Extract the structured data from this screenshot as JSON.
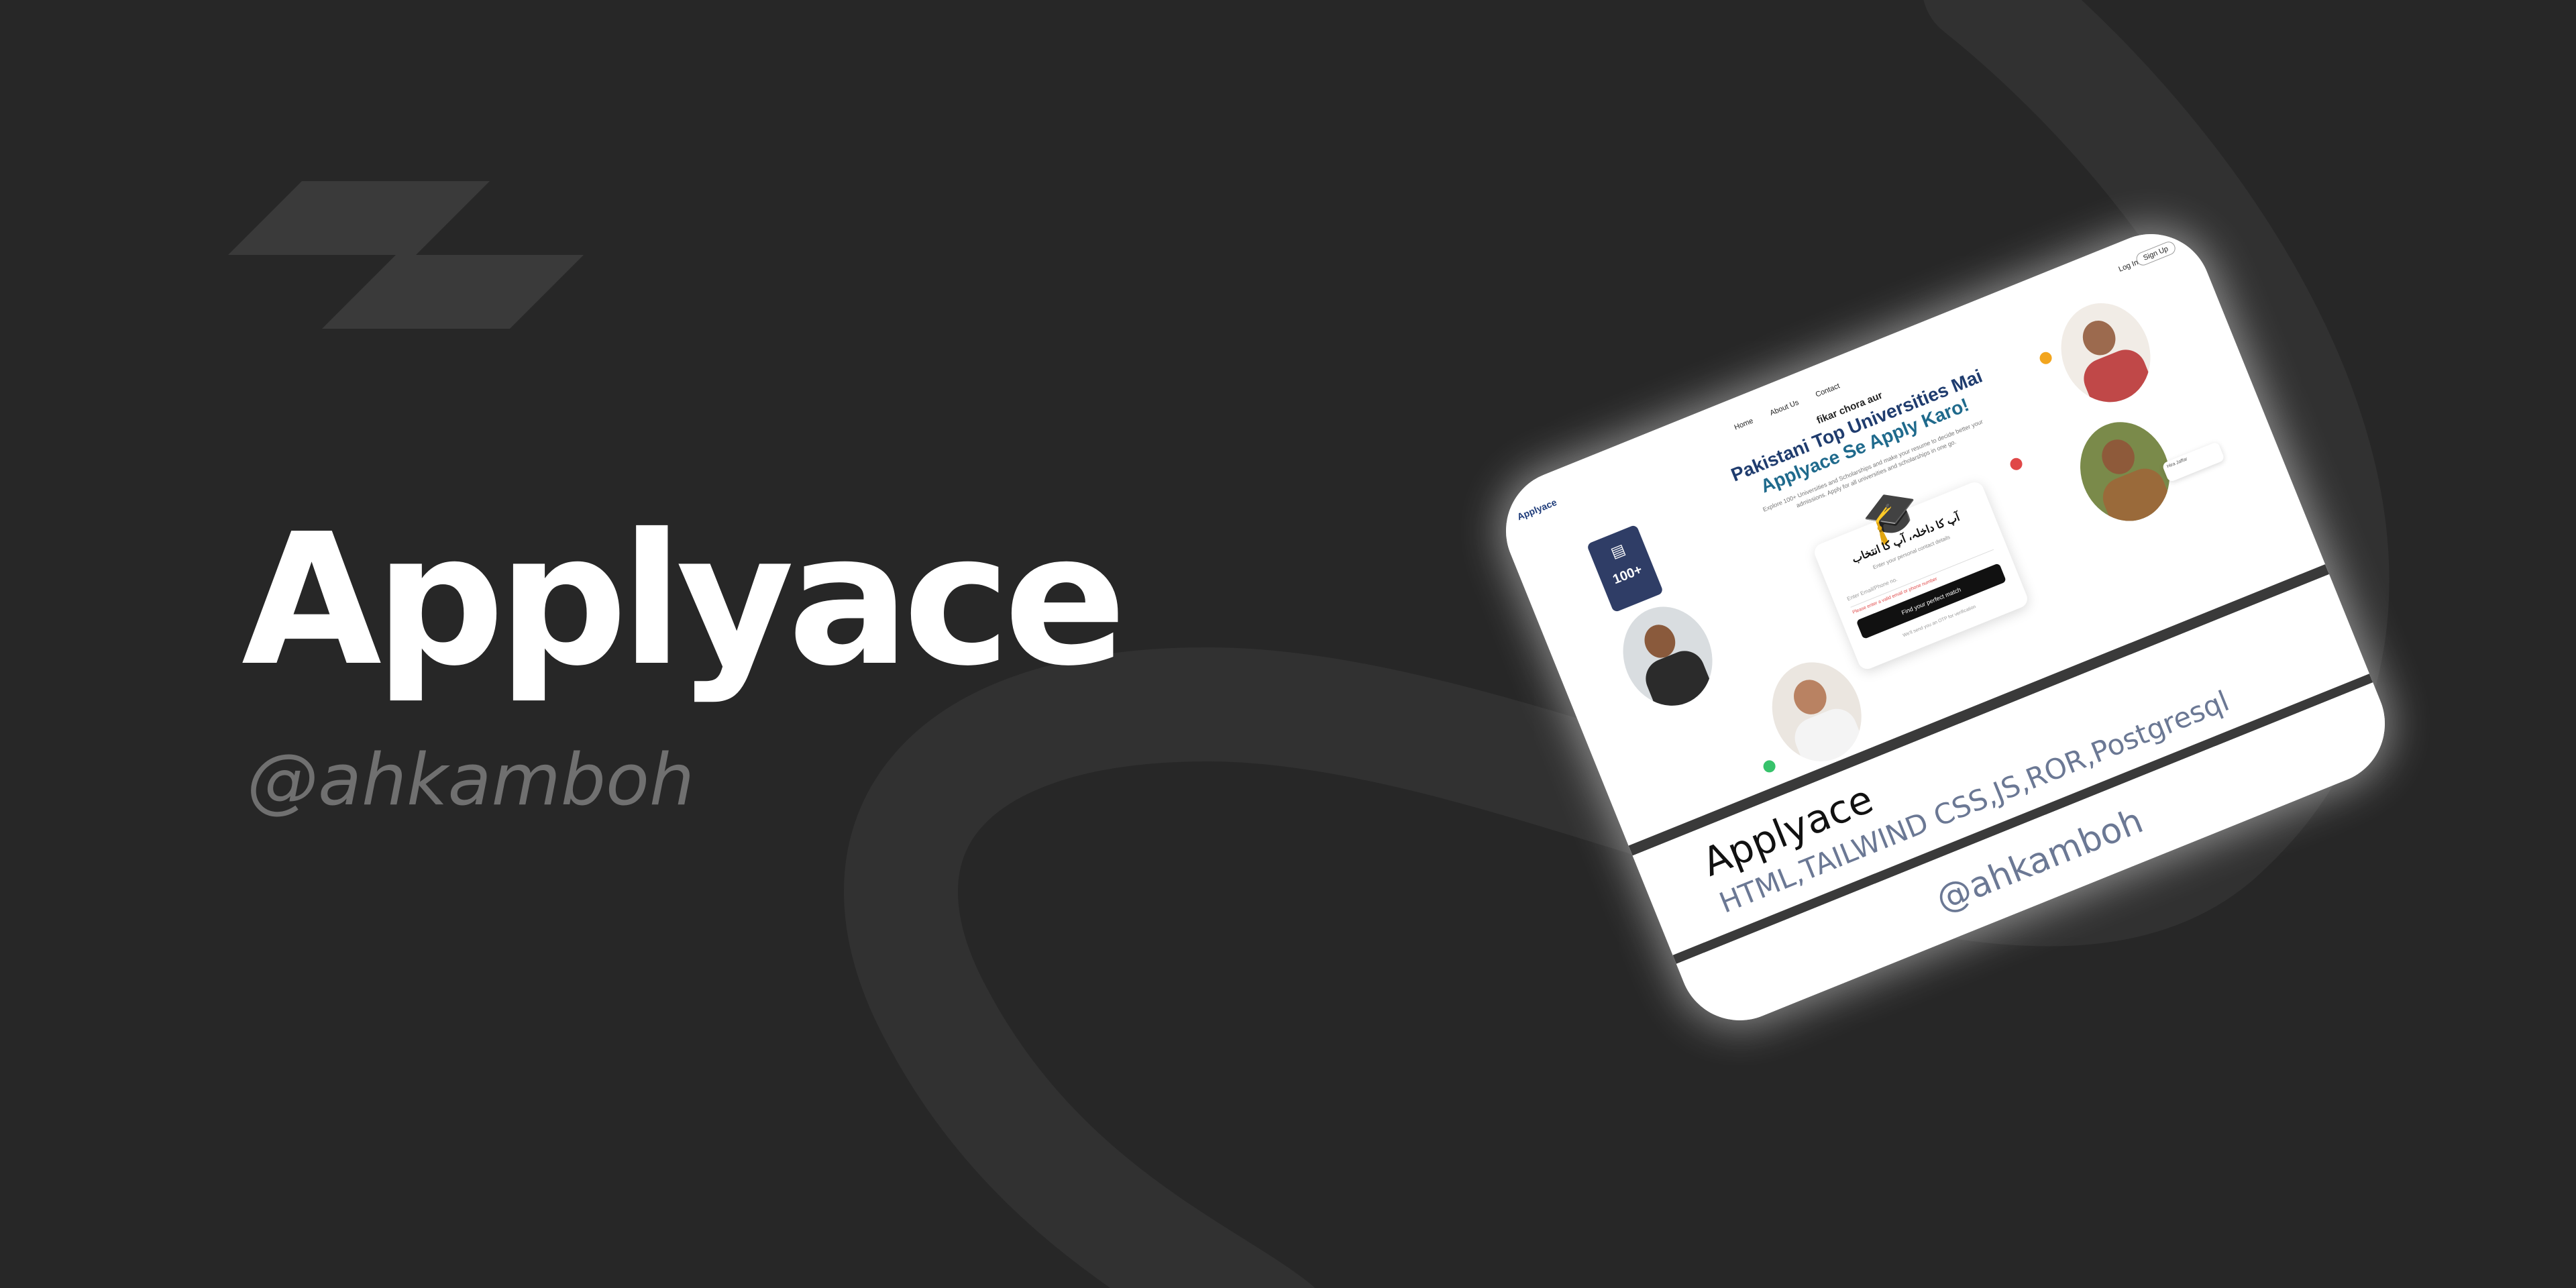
{
  "hero": {
    "title": "Applyace",
    "handle": "@ahkamboh"
  },
  "mockup": {
    "nav": {
      "brand": "Applyace",
      "links": [
        "Home",
        "About Us",
        "Contact"
      ],
      "login": "Log In",
      "signup": "Sign Up"
    },
    "headline": {
      "small": "fikar chora aur",
      "line1": "Pakistani Top Universities Mai",
      "line2": "Applyace Se Apply Karo!",
      "paragraph": "Explore 100+ Universities and Scholarships and make your resume to decide better your admissions. Apply for all universities and scholarships in one go."
    },
    "badge_value": "100+",
    "form": {
      "urdu_title": "آپ کا داخلہ، آپ کا انتخاب",
      "subtitle": "Enter your personal contact details",
      "input_placeholder": "Enter Email/Phone no.",
      "error_text": "Please enter a valid email or phone number",
      "button": "Find your perfect match",
      "note": "We'll send you an OTP for verification"
    },
    "floating_tag": "Hira Jaffar"
  },
  "card_info": {
    "name": "Applyace",
    "stack": "HTML,TAILWIND CSS,JS,ROR,Postgresql",
    "handle": "@ahkamboh"
  },
  "colors": {
    "background": "#272727",
    "swoosh": "#313131",
    "logo": "#3a3a3a",
    "title": "#ffffff",
    "handle": "#707070",
    "card_text": "#6b7894"
  },
  "icons": [
    "brand-logo-icon",
    "graduation-cap-icon"
  ]
}
